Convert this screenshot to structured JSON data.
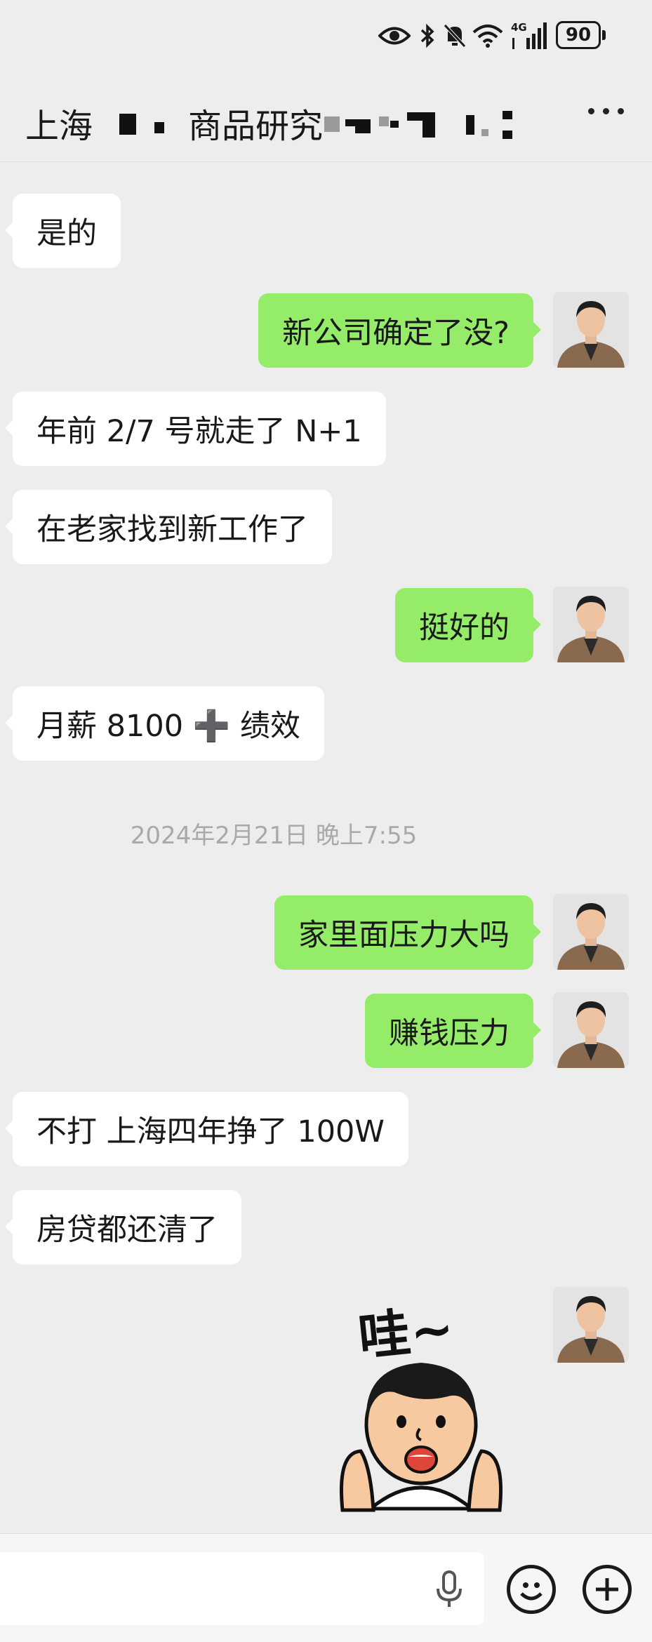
{
  "header": {
    "title_prefix": "上海",
    "title_mid": "商品研究"
  },
  "status_bar": {
    "network_label": "4G",
    "battery": "90"
  },
  "messages": [
    {
      "side": "in",
      "text": "是的"
    },
    {
      "side": "out",
      "text": "新公司确定了没?"
    },
    {
      "side": "in",
      "text": "年前 2/7 号就走了 N+1"
    },
    {
      "side": "in",
      "text": "在老家找到新工作了"
    },
    {
      "side": "out",
      "text": "挺好的"
    },
    {
      "side": "in",
      "text": "月薪 8100 ➕ 绩效"
    },
    {
      "side": "out",
      "text": "家里面压力大吗"
    },
    {
      "side": "out",
      "text": "赚钱压力"
    },
    {
      "side": "in",
      "text": "不打 上海四年挣了 100W"
    },
    {
      "side": "in",
      "text": "房贷都还清了"
    }
  ],
  "timestamp": "2024年2月21日 晚上7:55",
  "sticker": {
    "text": "哇~"
  },
  "colors": {
    "outgoing_bubble": "#95ec69",
    "incoming_bubble": "#ffffff",
    "background": "#ededed"
  }
}
